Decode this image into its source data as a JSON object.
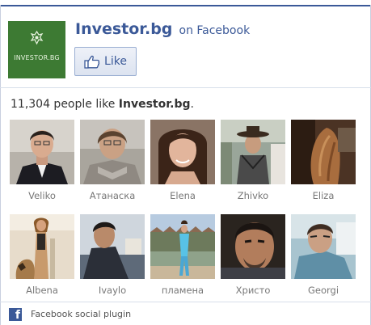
{
  "header": {
    "logo_text": "INVESTOR.BG",
    "page_name": "Investor.bg",
    "on_facebook": "on Facebook",
    "like_label": "Like"
  },
  "count": {
    "prefix": "11,304 people like ",
    "page_name": "Investor.bg",
    "suffix": "."
  },
  "faces": [
    {
      "name": "Veliko"
    },
    {
      "name": "Атанаска"
    },
    {
      "name": "Elena"
    },
    {
      "name": "Zhivko"
    },
    {
      "name": "Eliza"
    },
    {
      "name": "Albena"
    },
    {
      "name": "Ivaylo"
    },
    {
      "name": "пламена"
    },
    {
      "name": "Христо"
    },
    {
      "name": "Georgi"
    }
  ],
  "footer": {
    "icon_letter": "f",
    "text": "Facebook social plugin"
  },
  "colors": {
    "brand_blue": "#3b5998",
    "logo_green": "#3d7a33",
    "name_gray": "#777777"
  }
}
